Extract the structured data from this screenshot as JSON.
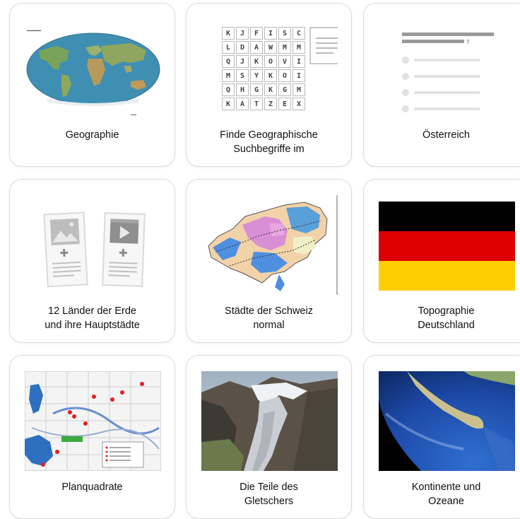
{
  "cards": [
    {
      "id": "geographie",
      "label": "Geographie",
      "thumbnail": "world-map"
    },
    {
      "id": "finde",
      "label": "Finde Geographische\nSuchbegriffe im",
      "thumbnail": "wordsearch"
    },
    {
      "id": "oesterreich",
      "label": "Österreich",
      "thumbnail": "quiz-placeholder"
    },
    {
      "id": "laender",
      "label": "12 Länder der Erde\nund ihre Hauptstädte",
      "thumbnail": "media-placeholder"
    },
    {
      "id": "schweiz",
      "label": "Städte der Schweiz\nnormal",
      "thumbnail": "switzerland-map"
    },
    {
      "id": "deutschland",
      "label": "Topographie\nDeutschland",
      "thumbnail": "germany-flag"
    },
    {
      "id": "planquadrate",
      "label": "Planquadrate",
      "thumbnail": "city-map"
    },
    {
      "id": "gletscher",
      "label": "Die Teile des\nGletschers",
      "thumbnail": "glacier-photo"
    },
    {
      "id": "kontinente",
      "label": "Kontinente und\nOzeane",
      "thumbnail": "earth-photo"
    }
  ],
  "wordsearch": {
    "rows": [
      [
        "K",
        "J",
        "F",
        "I",
        "S",
        "C"
      ],
      [
        "L",
        "D",
        "A",
        "W",
        "M",
        "M"
      ],
      [
        "Q",
        "J",
        "K",
        "O",
        "V",
        "I"
      ],
      [
        "M",
        "S",
        "Y",
        "K",
        "O",
        "I"
      ],
      [
        "Q",
        "H",
        "G",
        "K",
        "G",
        "M"
      ],
      [
        "K",
        "A",
        "T",
        "Z",
        "E",
        "X"
      ]
    ]
  },
  "colors": {
    "card_border": "#dcdcdc",
    "flag_black": "#000000",
    "flag_red": "#dd0000",
    "flag_gold": "#ffce00"
  }
}
